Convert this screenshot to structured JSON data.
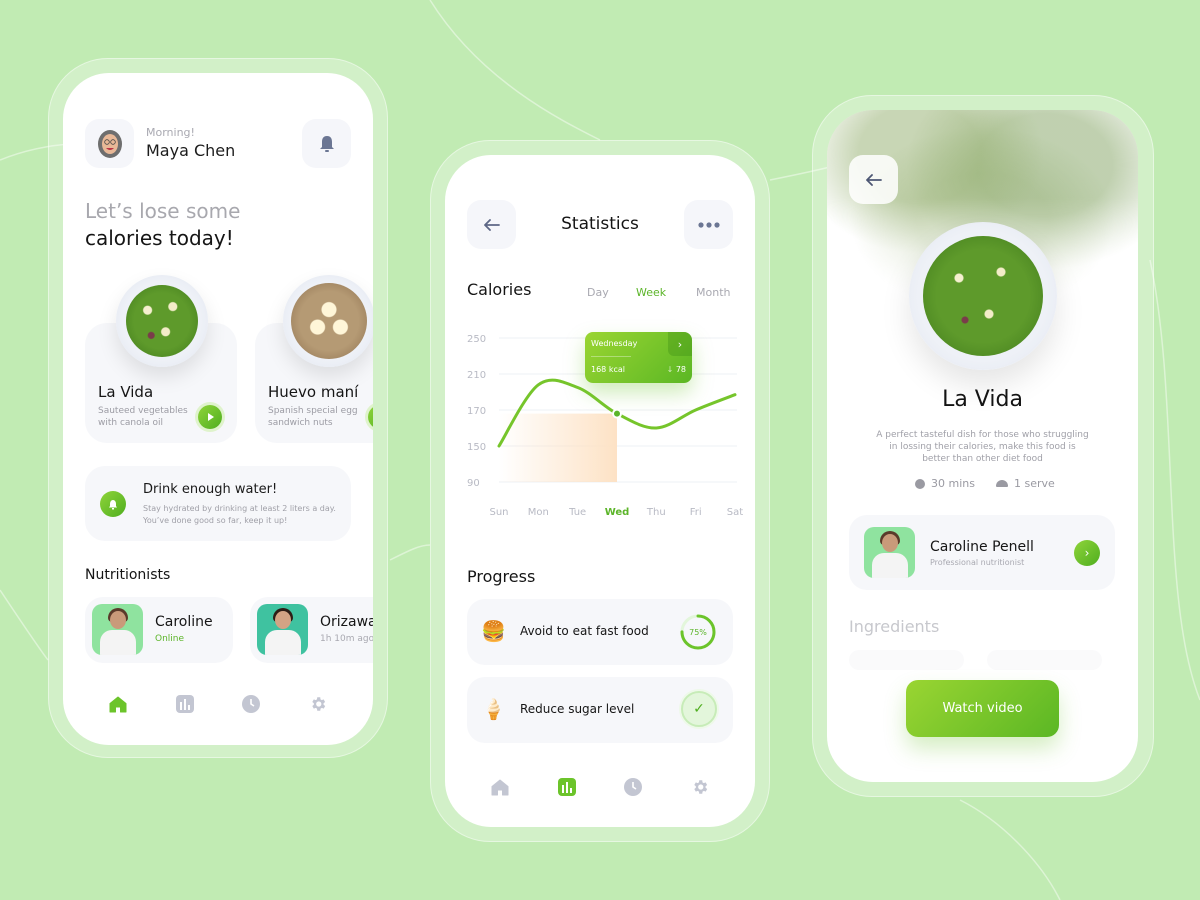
{
  "colors": {
    "background": "#c1ebb3",
    "accent": "#5cb52a",
    "card": "#f6f7fa",
    "muted": "#a9a9b1",
    "icon_inactive": "#c3c6d2",
    "chart_highlight": "#fde2c5"
  },
  "home": {
    "greeting": "Morning!",
    "user_name": "Maya Chen",
    "avatar_icon": "memoji-avatar",
    "notification_icon": "bell-icon",
    "headline_light": "Let’s lose some",
    "headline_dark": "calories today!",
    "foods": [
      {
        "title": "La Vida",
        "subtitle_line1": "Sauteed vegetables",
        "subtitle_line2": "with canola oil",
        "action_icon": "play-icon"
      },
      {
        "title": "Huevo maní",
        "subtitle_line1": "Spanish special egg",
        "subtitle_line2": "sandwich nuts",
        "action_icon": "play-icon"
      }
    ],
    "reminder": {
      "icon": "bell-icon",
      "title": "Drink enough water!",
      "line1": "Stay hydrated by drinking at least 2 liters a day.",
      "line2": "You’ve done good so far, keep it up!"
    },
    "nutritionists_title": "Nutritionists",
    "nutritionists": [
      {
        "name": "Caroline",
        "status": "Online",
        "status_color": "#5cb52a",
        "photo_bg": "#8fe39f"
      },
      {
        "name": "Orizawa",
        "status": "1h 10m ago",
        "status_color": "#a9a9b1",
        "photo_bg": "#3fc2a0"
      }
    ],
    "nav": [
      {
        "icon": "home-icon",
        "active": true
      },
      {
        "icon": "chart-icon",
        "active": false
      },
      {
        "icon": "clock-icon",
        "active": false
      },
      {
        "icon": "gear-icon",
        "active": false
      }
    ]
  },
  "statistics": {
    "back_icon": "arrow-left-icon",
    "title": "Statistics",
    "more_icon": "more-dots-icon",
    "calories_title": "Calories",
    "ranges": [
      "Day",
      "Week",
      "Month"
    ],
    "active_range": "Week",
    "tooltip": {
      "day": "Wednesday",
      "kcal": "168 kcal",
      "delta_icon": "arrow-down-icon",
      "delta": "78",
      "next_icon": "chevron-right-icon"
    },
    "progress_title": "Progress",
    "progress": [
      {
        "emoji": "🍔",
        "icon": "burger-icon",
        "label": "Avoid to eat fast food",
        "percent": 75,
        "percent_label": "75%",
        "done": false
      },
      {
        "emoji": "🍦",
        "icon": "ice-cream-icon",
        "label": "Reduce sugar level",
        "percent": 100,
        "done": true
      }
    ],
    "nav": [
      {
        "icon": "home-icon",
        "active": false
      },
      {
        "icon": "chart-icon",
        "active": true
      },
      {
        "icon": "clock-icon",
        "active": false
      },
      {
        "icon": "gear-icon",
        "active": false
      }
    ]
  },
  "chart_data": {
    "type": "line",
    "title": "Calories",
    "x": [
      "Sun",
      "Mon",
      "Tue",
      "Wed",
      "Thu",
      "Fri",
      "Sat"
    ],
    "active_x": "Wed",
    "y_ticks": [
      250,
      210,
      170,
      150,
      90
    ],
    "series": [
      {
        "name": "Calories",
        "values": [
          150,
          198,
          195,
          168,
          160,
          170,
          187
        ]
      }
    ],
    "highlight_range": [
      "Sun",
      "Wed"
    ],
    "highlight_value": 168,
    "grid": true,
    "legend": "none"
  },
  "detail": {
    "back_icon": "arrow-left-icon",
    "title": "La Vida",
    "description_line1": "A perfect tasteful dish for those who struggling",
    "description_line2": "in lossing their calories, make this food is",
    "description_line3": "better than other diet food",
    "time_icon": "clock-icon",
    "time": "30 mins",
    "serve_icon": "cloche-icon",
    "serves": "1 serve",
    "nutritionist": {
      "name": "Caroline Penell",
      "role": "Professional nutritionist",
      "photo_bg": "#8fe39f",
      "action_icon": "chevron-right-icon"
    },
    "ingredients_title": "Ingredients",
    "watch_button": "Watch video"
  }
}
